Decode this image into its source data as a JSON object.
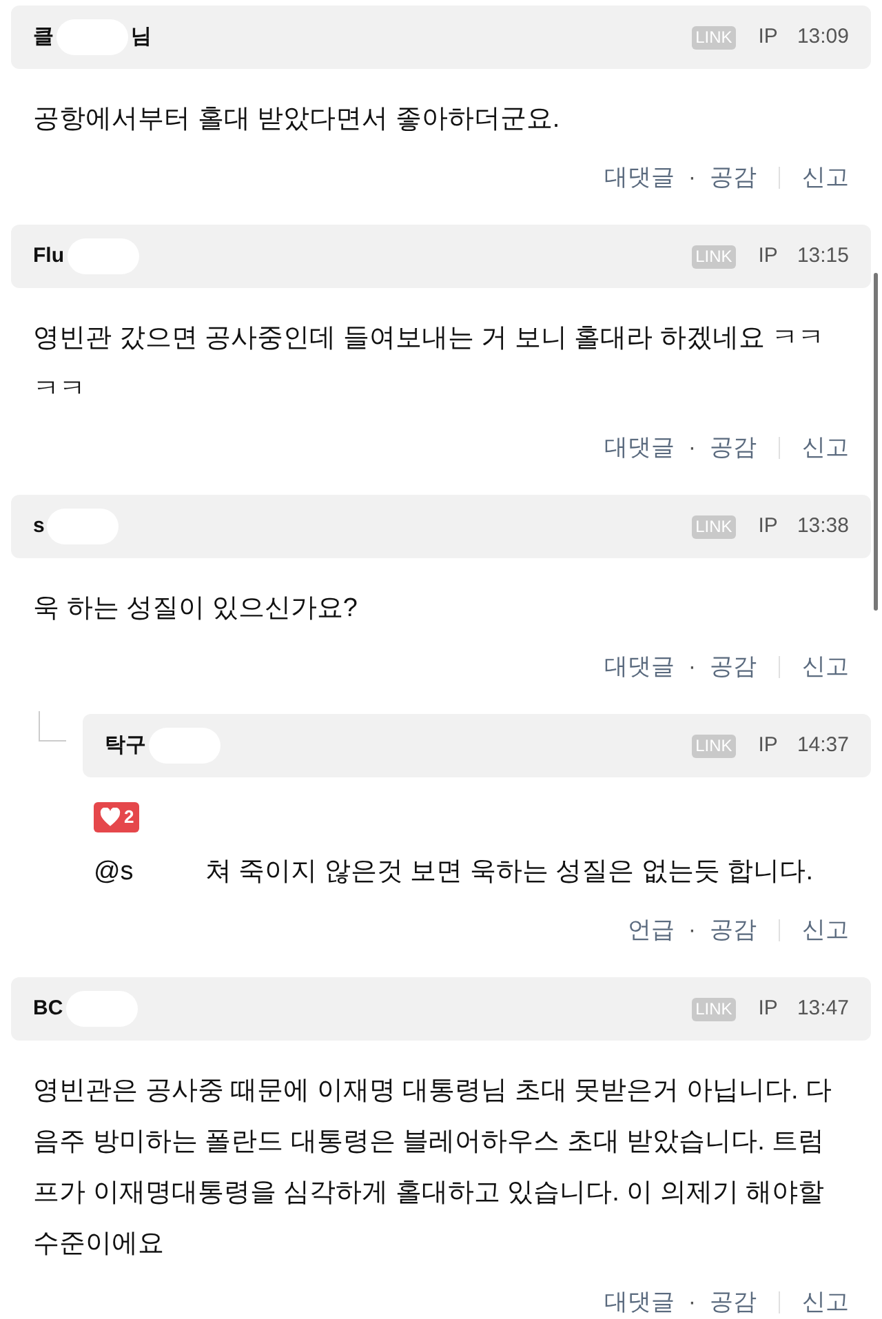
{
  "comments": [
    {
      "kind": "comment",
      "author": [
        {
          "kind": "text",
          "text": "클"
        },
        {
          "kind": "blur"
        },
        {
          "kind": "text",
          "text": "님"
        }
      ],
      "badge": "LINK",
      "ip": "IP",
      "time": "13:09",
      "separator": "·",
      "body": [
        {
          "kind": "text",
          "text": "공항에서부터 홀대 받았다면서 좋아하더군요."
        }
      ],
      "actions": [
        "대댓글",
        "공감",
        "신고"
      ]
    },
    {
      "kind": "comment",
      "author": [
        {
          "kind": "text",
          "text": "Flu"
        },
        {
          "kind": "blur"
        }
      ],
      "badge": "LINK",
      "ip": "IP",
      "time": "13:15",
      "separator": "·",
      "body": [
        {
          "kind": "text",
          "text": "영빈관 갔으면 공사중인데 들여보내는 거 보니 홀대라 하겠네요 ㅋㅋㅋㅋ"
        }
      ],
      "actions": [
        "대댓글",
        "공감",
        "신고"
      ]
    },
    {
      "kind": "comment",
      "author": [
        {
          "kind": "text",
          "text": "s"
        },
        {
          "kind": "blur"
        }
      ],
      "badge": "LINK",
      "ip": "IP",
      "time": "13:38",
      "separator": "·",
      "body": [
        {
          "kind": "text",
          "text": "욱 하는 성질이 있으신가요?"
        }
      ],
      "actions": [
        "대댓글",
        "공감",
        "신고"
      ]
    },
    {
      "kind": "reply",
      "author": [
        {
          "kind": "text",
          "text": "탁구"
        },
        {
          "kind": "blur"
        }
      ],
      "badge": "LINK",
      "ip": "IP",
      "time": "14:37",
      "separator": "·",
      "likes": "2",
      "body": [
        {
          "kind": "text",
          "text": "@s"
        },
        {
          "kind": "blur"
        },
        {
          "kind": "text",
          "text": "쳐 죽이지 않은것 보면 욱하는 성질은 없는듯 합니다."
        }
      ],
      "actions": [
        "언급",
        "공감",
        "신고"
      ]
    },
    {
      "kind": "comment",
      "author": [
        {
          "kind": "text",
          "text": "BC"
        },
        {
          "kind": "blur"
        }
      ],
      "badge": "LINK",
      "ip": "IP",
      "time": "13:47",
      "separator": "·",
      "body": [
        {
          "kind": "text",
          "text": "영빈관은 공사중 때문에 이재명 대통령님 초대 못받은거 아닙니다. 다음주 방미하는 폴란드 대통령은 블레어하우스 초대 받았습니다. 트럼프가 이재명대통령을 심각하게 홀대하고 있습니다. 이 의제기 해야할 수준이에요"
        }
      ],
      "actions": [
        "대댓글",
        "공감",
        "신고"
      ]
    }
  ]
}
